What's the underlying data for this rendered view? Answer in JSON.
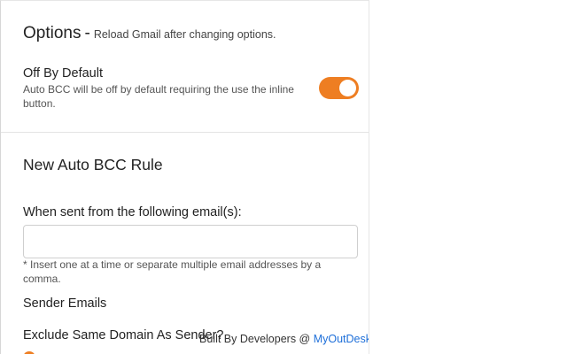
{
  "options": {
    "title": "Options",
    "dash": "-",
    "subtitle": "Reload Gmail after changing options."
  },
  "off_by_default": {
    "title": "Off By Default",
    "description": "Auto BCC will be off by default requiring the use the inline button.",
    "enabled": true
  },
  "new_rule": {
    "title": "New Auto BCC Rule",
    "from_label": "When sent from the following email(s):",
    "from_value": "",
    "hint": "* Insert one at a time or separate multiple email addresses by a comma.",
    "sender_emails_label": "Sender Emails",
    "exclude_label": "Exclude Same Domain As Sender?"
  },
  "footer": {
    "prefix": "Built By Developers @ ",
    "link_text": "MyOutDesk"
  },
  "colors": {
    "accent": "#ee7e22",
    "link": "#1e6fd9"
  }
}
